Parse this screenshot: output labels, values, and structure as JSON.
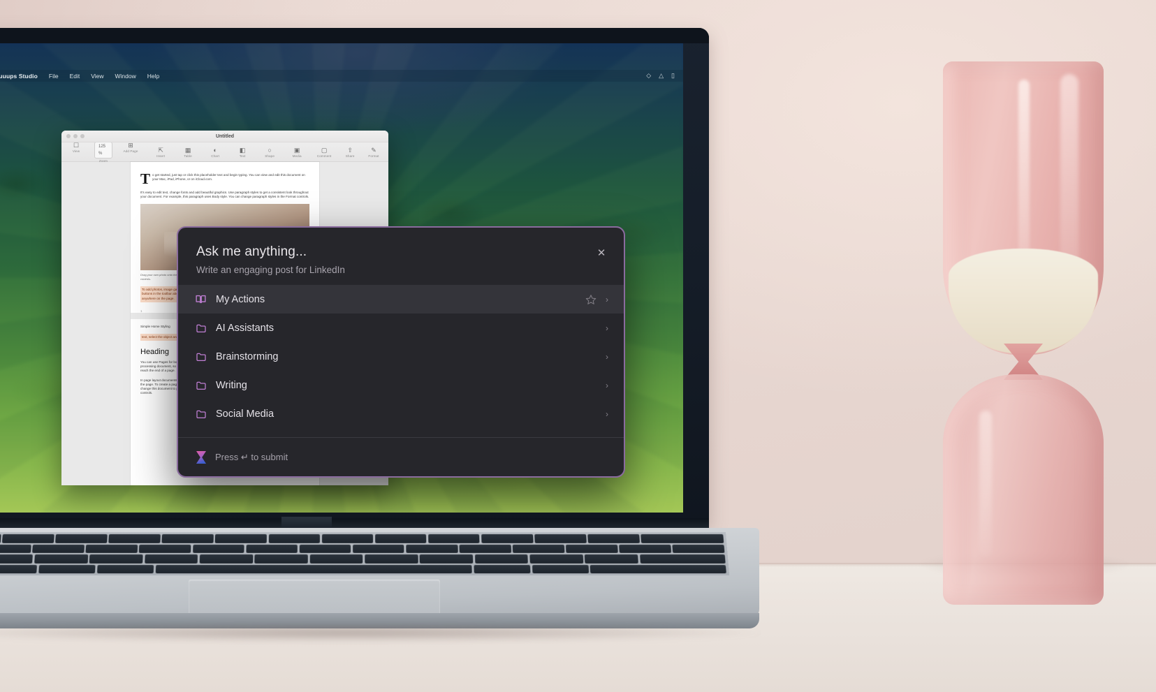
{
  "menubar": {
    "apple_icon": "apple-logo",
    "app_name": "Mockuuups Studio",
    "items": [
      "File",
      "Edit",
      "View",
      "Window",
      "Help"
    ],
    "status_icons": [
      "control-center-icon",
      "wifi-icon",
      "battery-icon"
    ]
  },
  "pages_window": {
    "title": "Untitled",
    "toolbar_left": [
      {
        "label": "View",
        "icon": "sidebar-icon"
      },
      {
        "label": "Zoom",
        "value": "125 %",
        "icon": "chevron-down-icon"
      },
      {
        "label": "Add Page",
        "icon": "add-page-icon"
      }
    ],
    "toolbar_center": [
      {
        "label": "Insert",
        "icon": "insert-icon"
      },
      {
        "label": "Table",
        "icon": "table-icon"
      },
      {
        "label": "Chart",
        "icon": "chart-icon"
      },
      {
        "label": "Text",
        "icon": "text-icon"
      },
      {
        "label": "Shape",
        "icon": "shape-icon"
      },
      {
        "label": "Media",
        "icon": "media-icon"
      },
      {
        "label": "Comment",
        "icon": "comment-icon"
      }
    ],
    "toolbar_right": [
      {
        "label": "Share",
        "icon": "share-icon"
      },
      {
        "label": "Format",
        "icon": "paintbrush-icon"
      }
    ],
    "document": {
      "dropcap": "T",
      "intro": "o get started, just tap or click this placeholder text and begin typing. You can view and edit this document on your Mac, iPad, iPhone, or on iCloud.com.",
      "para2": "It's easy to edit text, change fonts and add beautiful graphics. Use paragraph styles to get a consistent look throughout your document. For example, this paragraph uses Body style. You can change paragraph styles in the Format controls.",
      "photo_caption": "Drag your own photo onto the image placeholder to replace it. Tap or click this placeholder and select a new photo from the Format controls.",
      "highlight1": "To add photos, image galleries, text boxes, tables, charts and any of the 700 customisable shapes, tap or click the buttons in the toolbar above, or drag and drop the objects directly onto the page. Then resize them and place them anywhere on the page.",
      "page_number": "1",
      "section_label": "Simple Home Styling",
      "highlight2": "text, select the object and then choose options in the Format controls.",
      "heading": "Heading",
      "para_last": "You can use Pages for both word processing and page layout. In the Contemporary Report template, you're in a word processing document, so text flows from one page to the next, and new pages are created automatically when you reach the end of a page.",
      "para_last2": "In page layout documents, images and other objects on the page, including text boxes, images and other objects on the page. To create a page layout document, choose a page layout template in the template chooser. You can also change this document to page layout on your Mac, iPad or iPhone by turning off Document Body in the Document controls."
    }
  },
  "modal": {
    "title": "Ask me anything...",
    "subtitle": "Write an engaging post for LinkedIn",
    "close_icon": "close-icon",
    "items": [
      {
        "label": "My Actions",
        "icon": "book-icon",
        "selected": true,
        "has_star": true,
        "chevron": "chevron-right-icon"
      },
      {
        "label": "AI Assistants",
        "icon": "folder-icon",
        "selected": false,
        "has_star": false,
        "chevron": "chevron-right-icon"
      },
      {
        "label": "Brainstorming",
        "icon": "folder-icon",
        "selected": false,
        "has_star": false,
        "chevron": "chevron-right-icon"
      },
      {
        "label": "Writing",
        "icon": "folder-icon",
        "selected": false,
        "has_star": false,
        "chevron": "chevron-right-icon"
      },
      {
        "label": "Social Media",
        "icon": "folder-icon",
        "selected": false,
        "has_star": false,
        "chevron": "chevron-right-icon"
      }
    ],
    "footer": {
      "logo_icon": "hourglass-logo-icon",
      "text": "Press ↵ to submit"
    },
    "colors": {
      "border": "#8a6b9e",
      "background": "#26262b",
      "selected_row": "#34343a",
      "icon_purple": "#c07fd4",
      "title_text": "#e9e6ea",
      "subtitle_text": "#a8a4ad",
      "logo_gradient_start": "#e05fa8",
      "logo_gradient_end": "#3f5fd0"
    }
  }
}
